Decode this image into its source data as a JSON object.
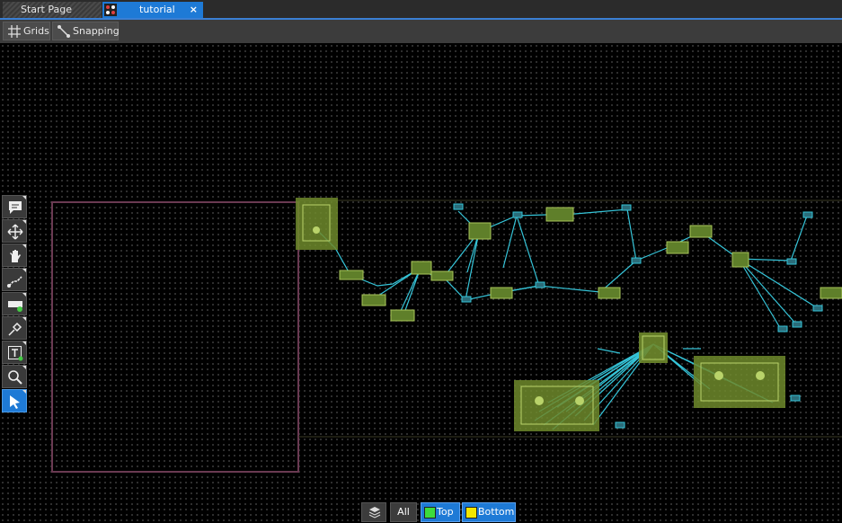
{
  "tabs": [
    {
      "label": "Start Page"
    },
    {
      "label": "tutorial",
      "close": "×"
    }
  ],
  "toolbar": {
    "grids_label": "Grids",
    "snapping_label": "Snapping"
  },
  "tools": [
    {
      "name": "comment-tool",
      "icon": "comment-icon"
    },
    {
      "name": "move-tool",
      "icon": "move-arrows-icon"
    },
    {
      "name": "pan-tool",
      "icon": "hand-icon"
    },
    {
      "name": "route-tool",
      "icon": "route-icon"
    },
    {
      "name": "place-tool",
      "icon": "place-component-icon"
    },
    {
      "name": "probe-tool",
      "icon": "probe-icon"
    },
    {
      "name": "text-tool",
      "icon": "text-icon"
    },
    {
      "name": "zoom-tool",
      "icon": "zoom-icon"
    },
    {
      "name": "select-tool",
      "icon": "pointer-icon",
      "active": true
    }
  ],
  "layers": {
    "all_label": "All",
    "top_label": "Top",
    "bottom_label": "Bottom",
    "top_color": "#3ddc3d",
    "bottom_color": "#f2e600"
  },
  "colors": {
    "accent": "#1e7ad6",
    "trace": "#35c4d8",
    "component": "#9cb84a",
    "board_outline": "#6a3a52"
  }
}
